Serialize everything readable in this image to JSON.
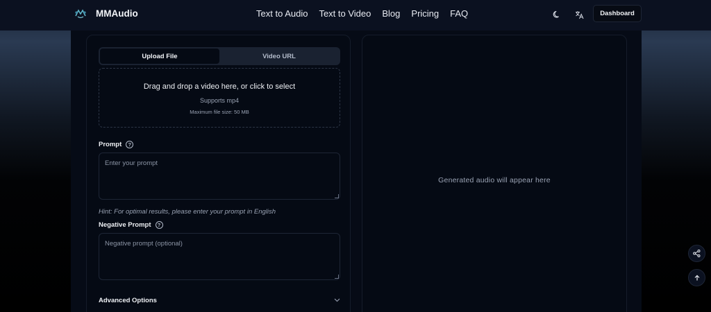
{
  "header": {
    "brand": "MMAudio",
    "nav": [
      "Text to Audio",
      "Text to Video",
      "Blog",
      "Pricing",
      "FAQ"
    ],
    "dashboard_label": "Dashboard",
    "icons": [
      "moon-icon",
      "translate-icon"
    ]
  },
  "left_panel": {
    "tabs": [
      "Upload File",
      "Video URL"
    ],
    "active_tab": "Upload File",
    "dropzone": {
      "title": "Drag and drop a video here, or click to select",
      "supports": "Supports mp4",
      "max_size": "Maximum file size: 50 MB"
    },
    "prompt": {
      "label": "Prompt",
      "placeholder": "Enter your prompt",
      "value": "",
      "hint": "Hint: For optimal results, please enter your prompt in English"
    },
    "negative_prompt": {
      "label": "Negative Prompt",
      "placeholder": "Negative prompt (optional)",
      "value": ""
    },
    "advanced_label": "Advanced Options"
  },
  "right_panel": {
    "placeholder": "Generated audio will appear here"
  },
  "floating": {
    "icons": [
      "share-icon",
      "arrow-up-icon"
    ]
  },
  "colors": {
    "header_bg": "#0b1120",
    "panel_bg": "#050a14",
    "tab_bg": "#1a2231"
  }
}
